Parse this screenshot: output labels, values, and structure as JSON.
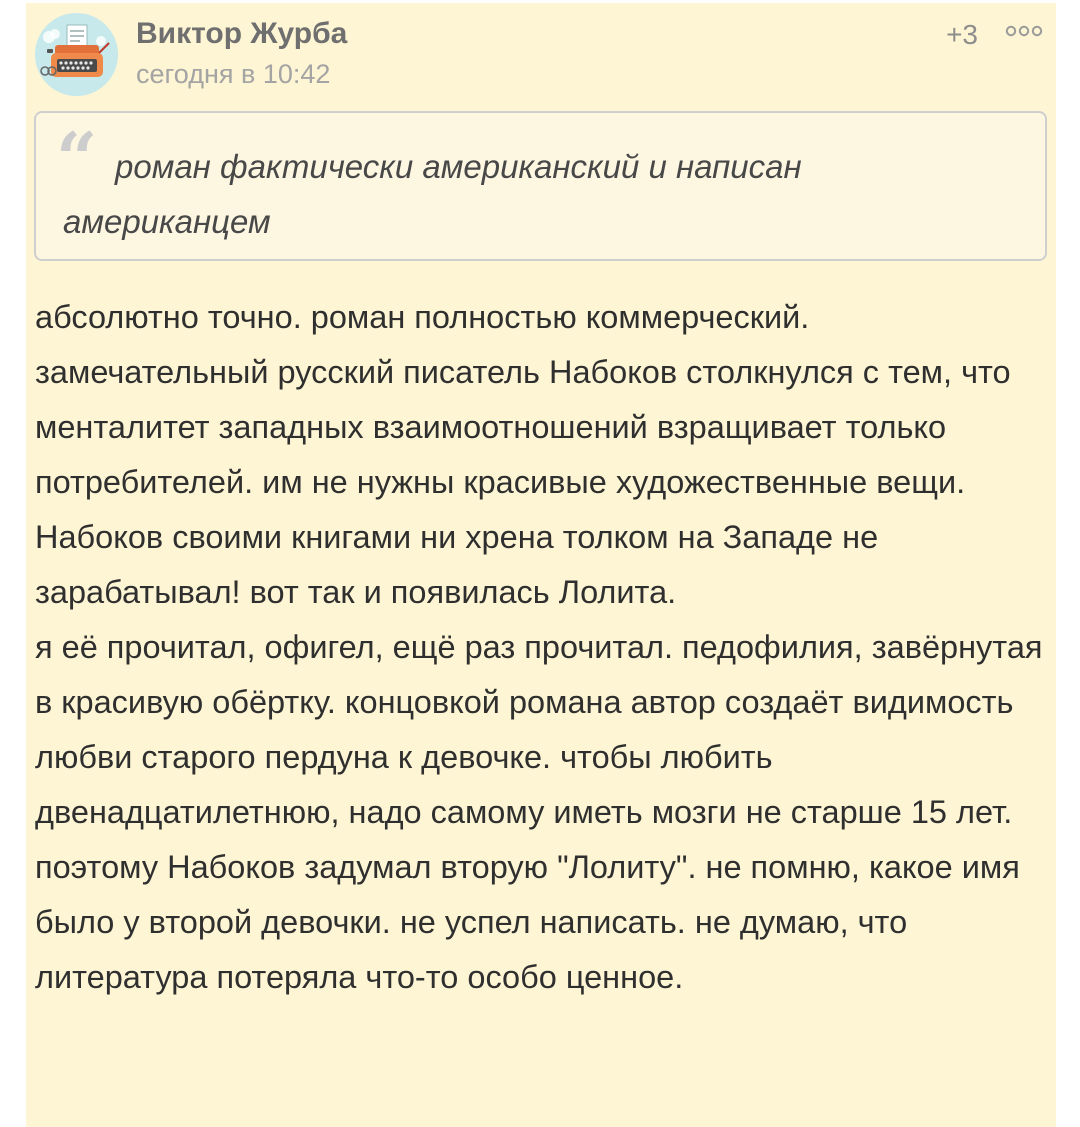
{
  "comment": {
    "author": "Виктор Журба",
    "timestamp": "сегодня в 10:42",
    "rating": "+3",
    "more_icon": "more-dots-icon",
    "avatar_icon": "typewriter-avatar-icon",
    "quote": {
      "mark": "“",
      "text": "роман фактически американский и написан американцем"
    },
    "paragraphs": [
      "абсолютно точно. роман полностью коммерческий. замечательный русский писатель Набоков столкнулся с тем, что менталитет западных взаимоотношений взращивает только потребителей. им не нужны красивые художественные вещи. Набоков своими книгами ни хрена толком на Западе не зарабатывал! вот так и появилась Лолита.",
      "я её прочитал, офигел, ещё раз прочитал. педофилия, завёрнутая в красивую обёртку. концовкой романа автор создаёт видимость любви старого пердуна к девочке. чтобы любить двенадцатилетнюю, надо самому иметь мозги не старше 15 лет.",
      "поэтому Набоков задумал вторую \"Лолиту\". не помню, какое имя было у второй девочки. не успел написать. не думаю, что литература потеряла что-то особо ценное."
    ]
  },
  "colors": {
    "card_background": "#fdf5d3",
    "author": "#6f6f6f",
    "timestamp": "#a4a4a4",
    "body_text": "#2f2f2f",
    "quote_border": "#cfcfcf"
  }
}
